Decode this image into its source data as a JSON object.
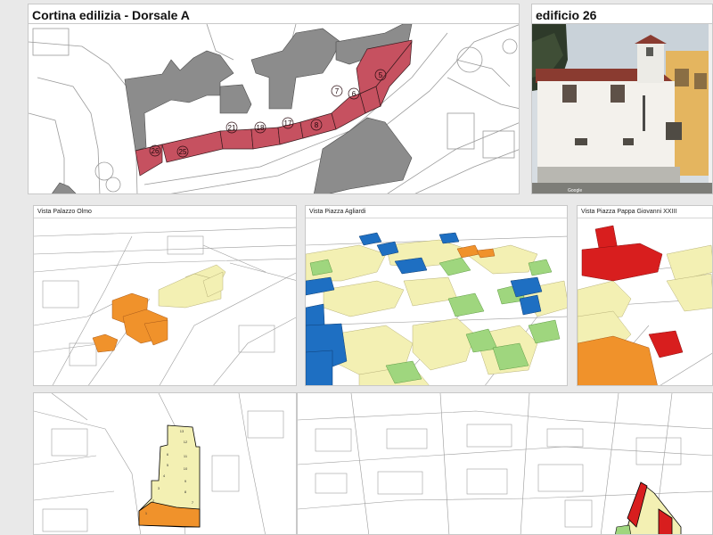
{
  "panels": {
    "cortina": {
      "title": "Cortina edilizia - Dorsale A",
      "building_labels": [
        "26",
        "25",
        "21",
        "18",
        "17",
        "8",
        "7",
        "6",
        "5"
      ]
    },
    "edificio": {
      "title": "edificio 26",
      "watermark": "Google"
    },
    "view_olmo": {
      "title": "Vista Palazzo Olmo"
    },
    "view_agliardi": {
      "title": "Vista Piazza Agliardi"
    },
    "view_papa": {
      "title": "Vista Piazza Pappa Giovanni XXIII"
    }
  },
  "plan_unit_labels": [
    "13",
    "12",
    "11",
    "10",
    "9",
    "8",
    "7",
    "6",
    "5",
    "4",
    "3",
    "2",
    "1"
  ],
  "colors": {
    "section_red": "#c65160",
    "grey_building": "#8c8c8c",
    "class_red": "#d81e1e",
    "class_orange": "#f0922b",
    "class_light_yellow": "#f3f0b3",
    "class_green": "#9fd67e",
    "class_blue": "#1e6fc2"
  }
}
